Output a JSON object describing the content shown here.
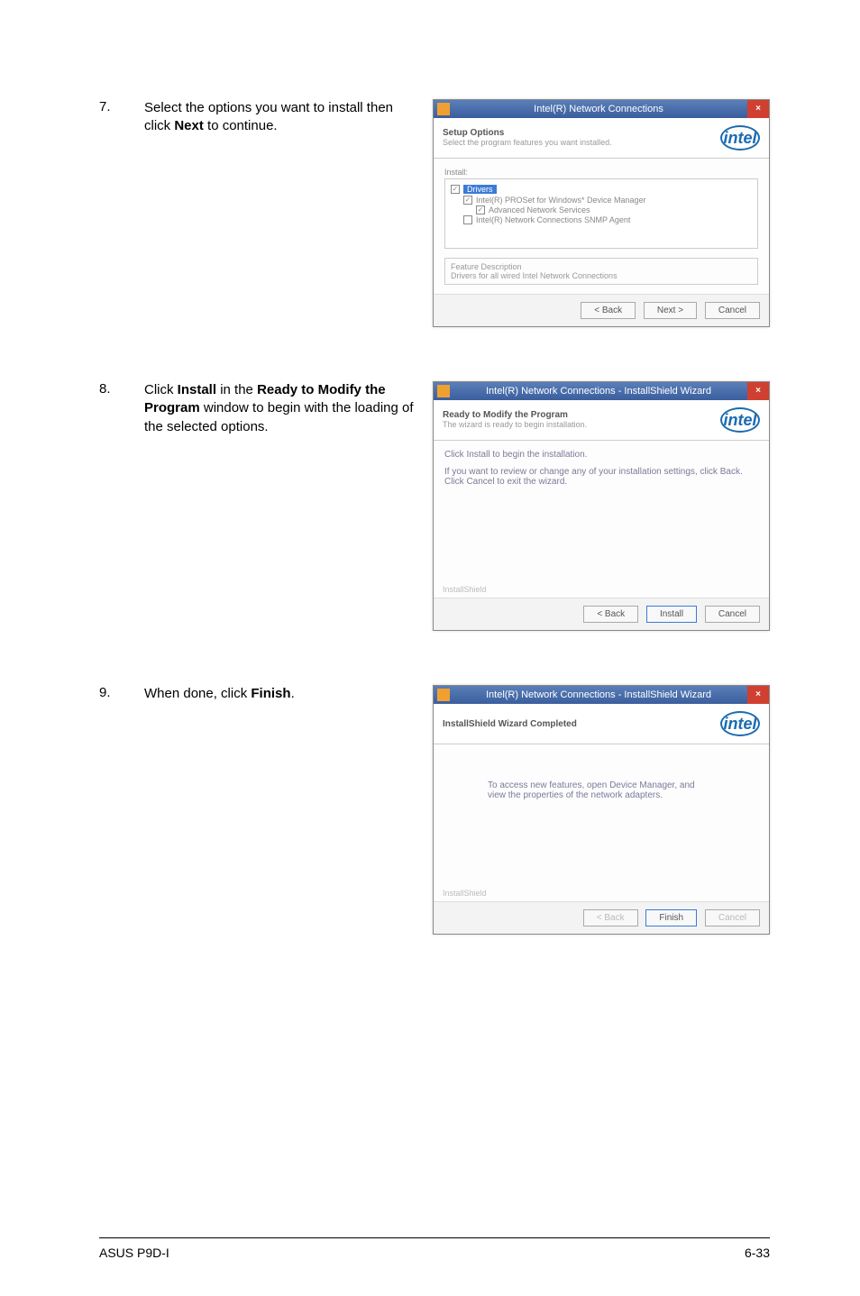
{
  "steps": {
    "s7": {
      "num": "7.",
      "text_before": "Select the options you want to install then click ",
      "bold": "Next",
      "text_after": " to continue."
    },
    "s8": {
      "num": "8.",
      "text_before": "Click ",
      "bold1": "Install",
      "mid": " in the ",
      "bold2": "Ready to Modify the Program",
      "text_after": " window to begin with the loading of the selected options."
    },
    "s9": {
      "num": "9.",
      "text_before": "When done, click ",
      "bold": "Finish",
      "text_after": "."
    }
  },
  "dlg7": {
    "title": "Intel(R) Network Connections",
    "close": "×",
    "header_bold": "Setup Options",
    "header_sub": "Select the program features you want installed.",
    "logo": "intel",
    "tree_label": "Install:",
    "drivers": "Drivers",
    "row1": "Intel(R) PROSet for Windows* Device Manager",
    "row2": "Advanced Network Services",
    "row3": "Intel(R) Network Connections SNMP Agent",
    "desc_title": "Feature Description",
    "desc_body": "Drivers for all wired Intel Network Connections",
    "back": "< Back",
    "next": "Next >",
    "cancel": "Cancel"
  },
  "dlg8": {
    "title": "Intel(R) Network Connections - InstallShield Wizard",
    "close": "×",
    "header_bold": "Ready to Modify the Program",
    "header_sub": "The wizard is ready to begin installation.",
    "logo": "intel",
    "line1": "Click Install to begin the installation.",
    "line2": "If you want to review or change any of your installation settings, click Back. Click Cancel to exit the wizard.",
    "shield": "InstallShield",
    "back": "< Back",
    "install": "Install",
    "cancel": "Cancel"
  },
  "dlg9": {
    "title": "Intel(R) Network Connections - InstallShield Wizard",
    "close": "×",
    "header_bold": "InstallShield Wizard Completed",
    "logo": "intel",
    "body": "To access new features, open Device Manager, and view the properties of the network adapters.",
    "shield": "InstallShield",
    "back": "< Back",
    "finish": "Finish",
    "cancel": "Cancel"
  },
  "footer": {
    "left": "ASUS P9D-I",
    "right": "6-33"
  }
}
